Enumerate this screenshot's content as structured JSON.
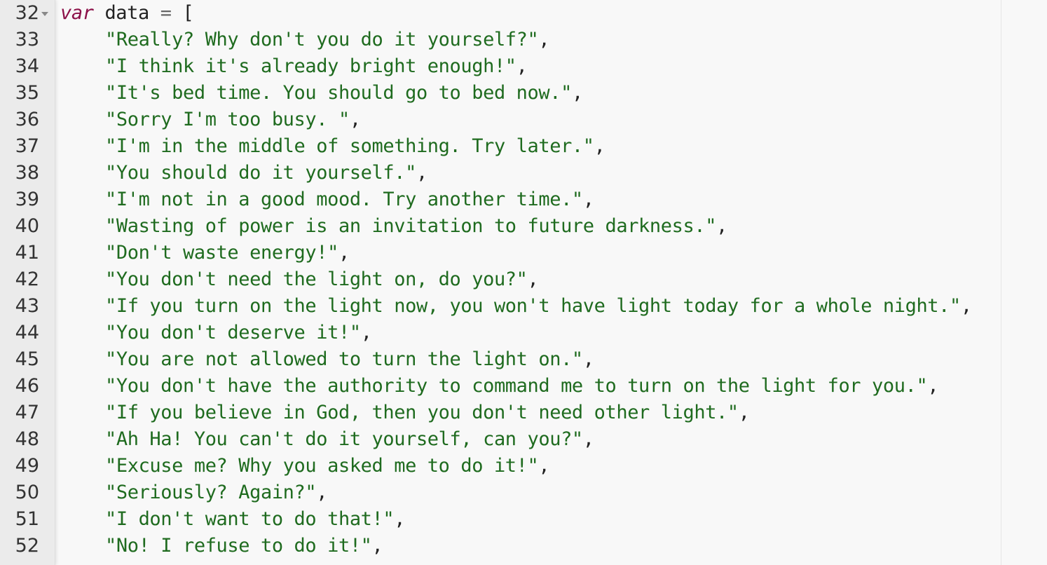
{
  "editor": {
    "declaration": {
      "line_number": "32",
      "keyword": "var",
      "identifier": "data",
      "operator": "=",
      "open_bracket": "["
    },
    "lines": [
      {
        "n": "33",
        "text": "\"Really? Why don't you do it yourself?\"",
        "punct": ","
      },
      {
        "n": "34",
        "text": "\"I think it's already bright enough!\"",
        "punct": ","
      },
      {
        "n": "35",
        "text": "\"It's bed time. You should go to bed now.\"",
        "punct": ","
      },
      {
        "n": "36",
        "text": "\"Sorry I'm too busy. \"",
        "punct": ","
      },
      {
        "n": "37",
        "text": "\"I'm in the middle of something. Try later.\"",
        "punct": ","
      },
      {
        "n": "38",
        "text": "\"You should do it yourself.\"",
        "punct": ","
      },
      {
        "n": "39",
        "text": "\"I'm not in a good mood. Try another time.\"",
        "punct": ","
      },
      {
        "n": "40",
        "text": "\"Wasting of power is an invitation to future darkness.\"",
        "punct": ","
      },
      {
        "n": "41",
        "text": "\"Don't waste energy!\"",
        "punct": ","
      },
      {
        "n": "42",
        "text": "\"You don't need the light on, do you?\"",
        "punct": ","
      },
      {
        "n": "43",
        "text": "\"If you turn on the light now, you won't have light today for a whole night.\"",
        "punct": ","
      },
      {
        "n": "44",
        "text": "\"You don't deserve it!\"",
        "punct": ","
      },
      {
        "n": "45",
        "text": "\"You are not allowed to turn the light on.\"",
        "punct": ","
      },
      {
        "n": "46",
        "text": "\"You don't have the authority to command me to turn on the light for you.\"",
        "punct": ","
      },
      {
        "n": "47",
        "text": "\"If you believe in God, then you don't need other light.\"",
        "punct": ","
      },
      {
        "n": "48",
        "text": "\"Ah Ha! You can't do it yourself, can you?\"",
        "punct": ","
      },
      {
        "n": "49",
        "text": "\"Excuse me? Why you asked me to do it!\"",
        "punct": ","
      },
      {
        "n": "50",
        "text": "\"Seriously? Again?\"",
        "punct": ","
      },
      {
        "n": "51",
        "text": "\"I don't want to do that!\"",
        "punct": ","
      },
      {
        "n": "52",
        "text": "\"No! I refuse to do it!\"",
        "punct": ","
      }
    ]
  },
  "colors": {
    "keyword": "#8b1048",
    "string": "#1f6b1f",
    "text": "#222222",
    "gutter_bg": "#ebebeb",
    "editor_bg": "#f8f8f8"
  },
  "icons": {
    "fold": "fold-arrow-icon"
  }
}
